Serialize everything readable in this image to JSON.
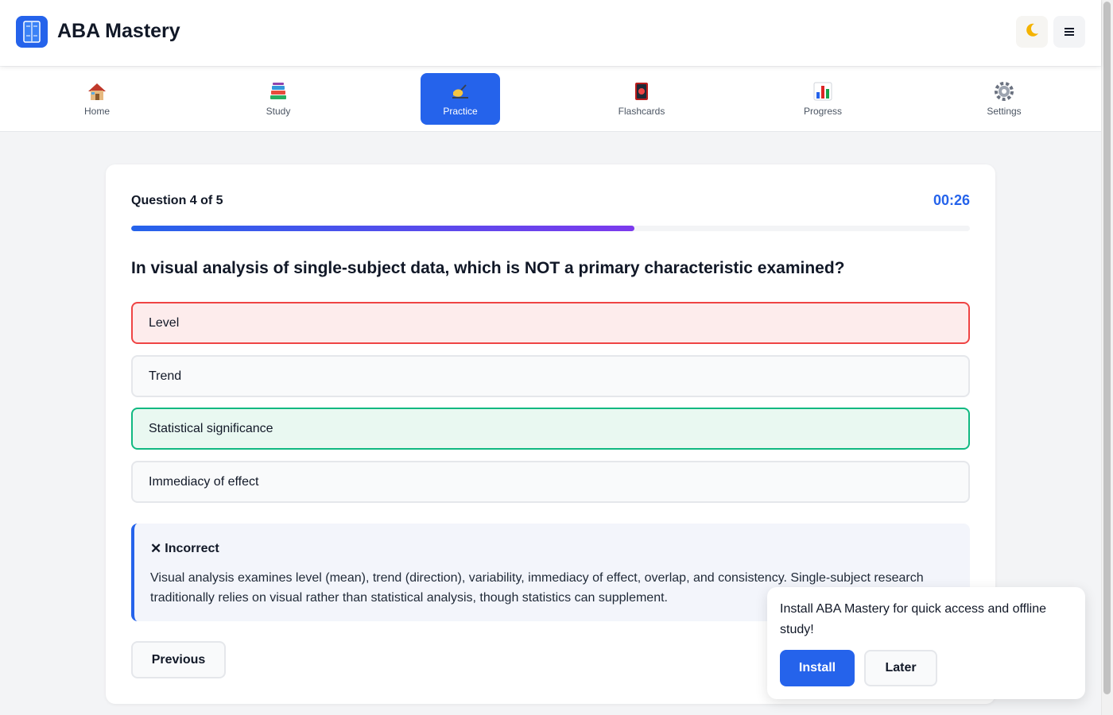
{
  "header": {
    "title": "ABA Mastery",
    "logo_icon": "book-icon",
    "theme_icon": "moon-icon",
    "menu_icon": "hamburger-menu-icon",
    "brand_color": "#2563eb"
  },
  "nav": {
    "items": [
      {
        "label": "Home",
        "icon": "house-icon",
        "active": false
      },
      {
        "label": "Study",
        "icon": "books-icon",
        "active": false
      },
      {
        "label": "Practice",
        "icon": "writing-hand-icon",
        "active": true
      },
      {
        "label": "Flashcards",
        "icon": "flashcard-icon",
        "active": false
      },
      {
        "label": "Progress",
        "icon": "bar-chart-icon",
        "active": false
      },
      {
        "label": "Settings",
        "icon": "gear-icon",
        "active": false
      }
    ]
  },
  "quiz": {
    "counter": "Question 4 of 5",
    "timer": "00:26",
    "progress_fraction": 0.6,
    "question": "In visual analysis of single-subject data, which is NOT a primary characteristic examined?",
    "options": [
      {
        "label": "Level",
        "state": "incorrect"
      },
      {
        "label": "Trend",
        "state": "default"
      },
      {
        "label": "Statistical significance",
        "state": "correct"
      },
      {
        "label": "Immediacy of effect",
        "state": "default"
      }
    ],
    "feedback": {
      "icon": "close-icon",
      "title": "Incorrect",
      "text": "Visual analysis examines level (mean), trend (direction), variability, immediacy of effect, overlap, and consistency. Single-subject research traditionally relies on visual rather than statistical analysis, though statistics can supplement."
    },
    "previous_label": "Previous",
    "colors": {
      "incorrect": "#ef4444",
      "correct": "#10b981",
      "progress_start": "#2563eb",
      "progress_end": "#7c3aed"
    }
  },
  "install_banner": {
    "text": "Install ABA Mastery for quick access and offline study!",
    "install_label": "Install",
    "later_label": "Later"
  }
}
